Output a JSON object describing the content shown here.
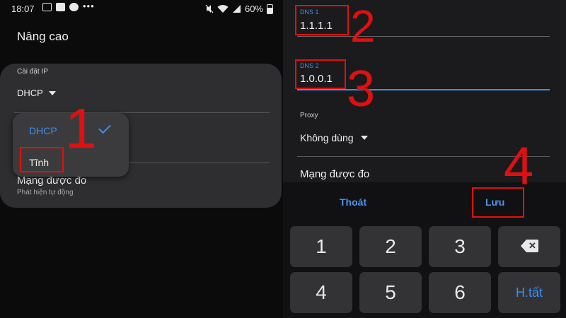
{
  "left": {
    "status": {
      "time": "18:07",
      "battery": "60%"
    },
    "title": "Nâng cao",
    "ip_setting_label": "Cài đặt IP",
    "ip_setting_value": "DHCP",
    "dropdown": {
      "option_dhcp": "DHCP",
      "option_static": "Tĩnh"
    },
    "metered_title": "Mạng được đo",
    "metered_sub": "Phát hiện tự động"
  },
  "right": {
    "dns1_label": "DNS 1",
    "dns1_value": "1.1.1.1",
    "dns2_label": "DNS 2",
    "dns2_value": "1.0.0.1",
    "proxy_label": "Proxy",
    "proxy_value": "Không dùng",
    "metered_title": "Mạng được đo",
    "keyboard": {
      "cancel": "Thoát",
      "save": "Lưu",
      "keys": [
        "1",
        "2",
        "3",
        "4",
        "5",
        "6"
      ],
      "done": "H.tất"
    }
  },
  "annotations": [
    "1",
    "2",
    "3",
    "4"
  ],
  "colors": {
    "accent": "#3a8ff0",
    "annotation": "#e01010"
  },
  "icons": [
    "image-icon",
    "notification-icon",
    "messenger-icon",
    "more-dots-icon",
    "mute-icon",
    "wifi-icon",
    "signal-icon",
    "battery-icon",
    "dropdown-caret-icon",
    "check-icon",
    "backspace-icon"
  ]
}
